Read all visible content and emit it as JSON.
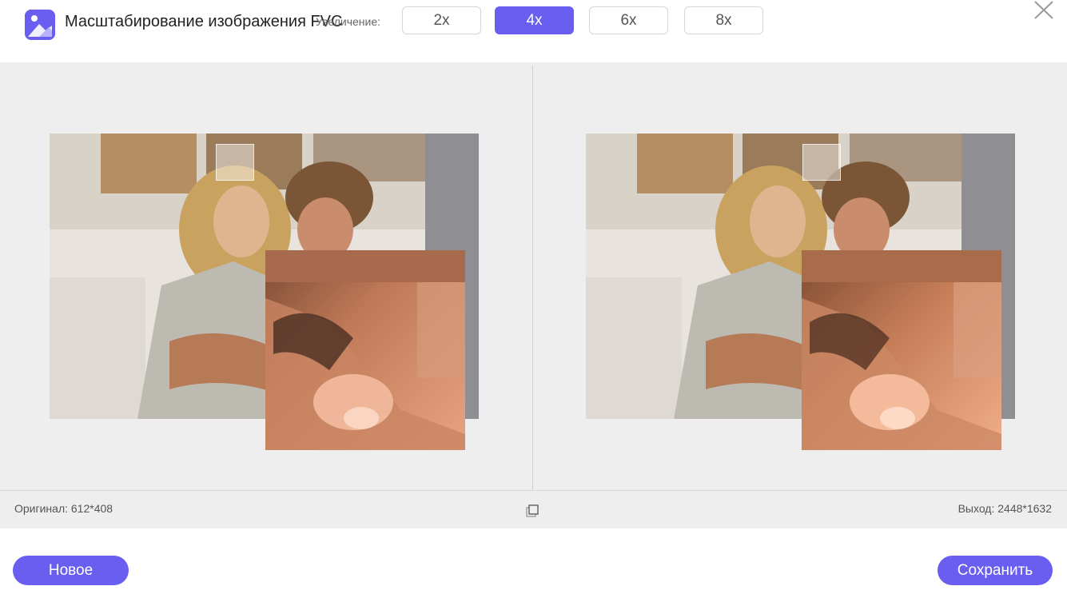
{
  "header": {
    "title": "Масштабирование изображения FVC",
    "magnification_label": "Увеличение:",
    "scales": [
      {
        "label": "2x",
        "active": false
      },
      {
        "label": "4x",
        "active": true
      },
      {
        "label": "6x",
        "active": false
      },
      {
        "label": "8x",
        "active": false
      }
    ],
    "close_icon": "close-icon"
  },
  "preview": {
    "original_image": "photo of smiling couple (original)",
    "output_image": "photo of smiling couple (upscaled)"
  },
  "infobar": {
    "original_label": "Оригинал: 612*408",
    "output_label": "Выход: 2448*1632",
    "compare_icon": "compare-icon"
  },
  "footer": {
    "new_label": "Новое",
    "save_label": "Сохранить"
  },
  "colors": {
    "accent": "#6a5ef0",
    "background_gray": "#eeeeee"
  }
}
